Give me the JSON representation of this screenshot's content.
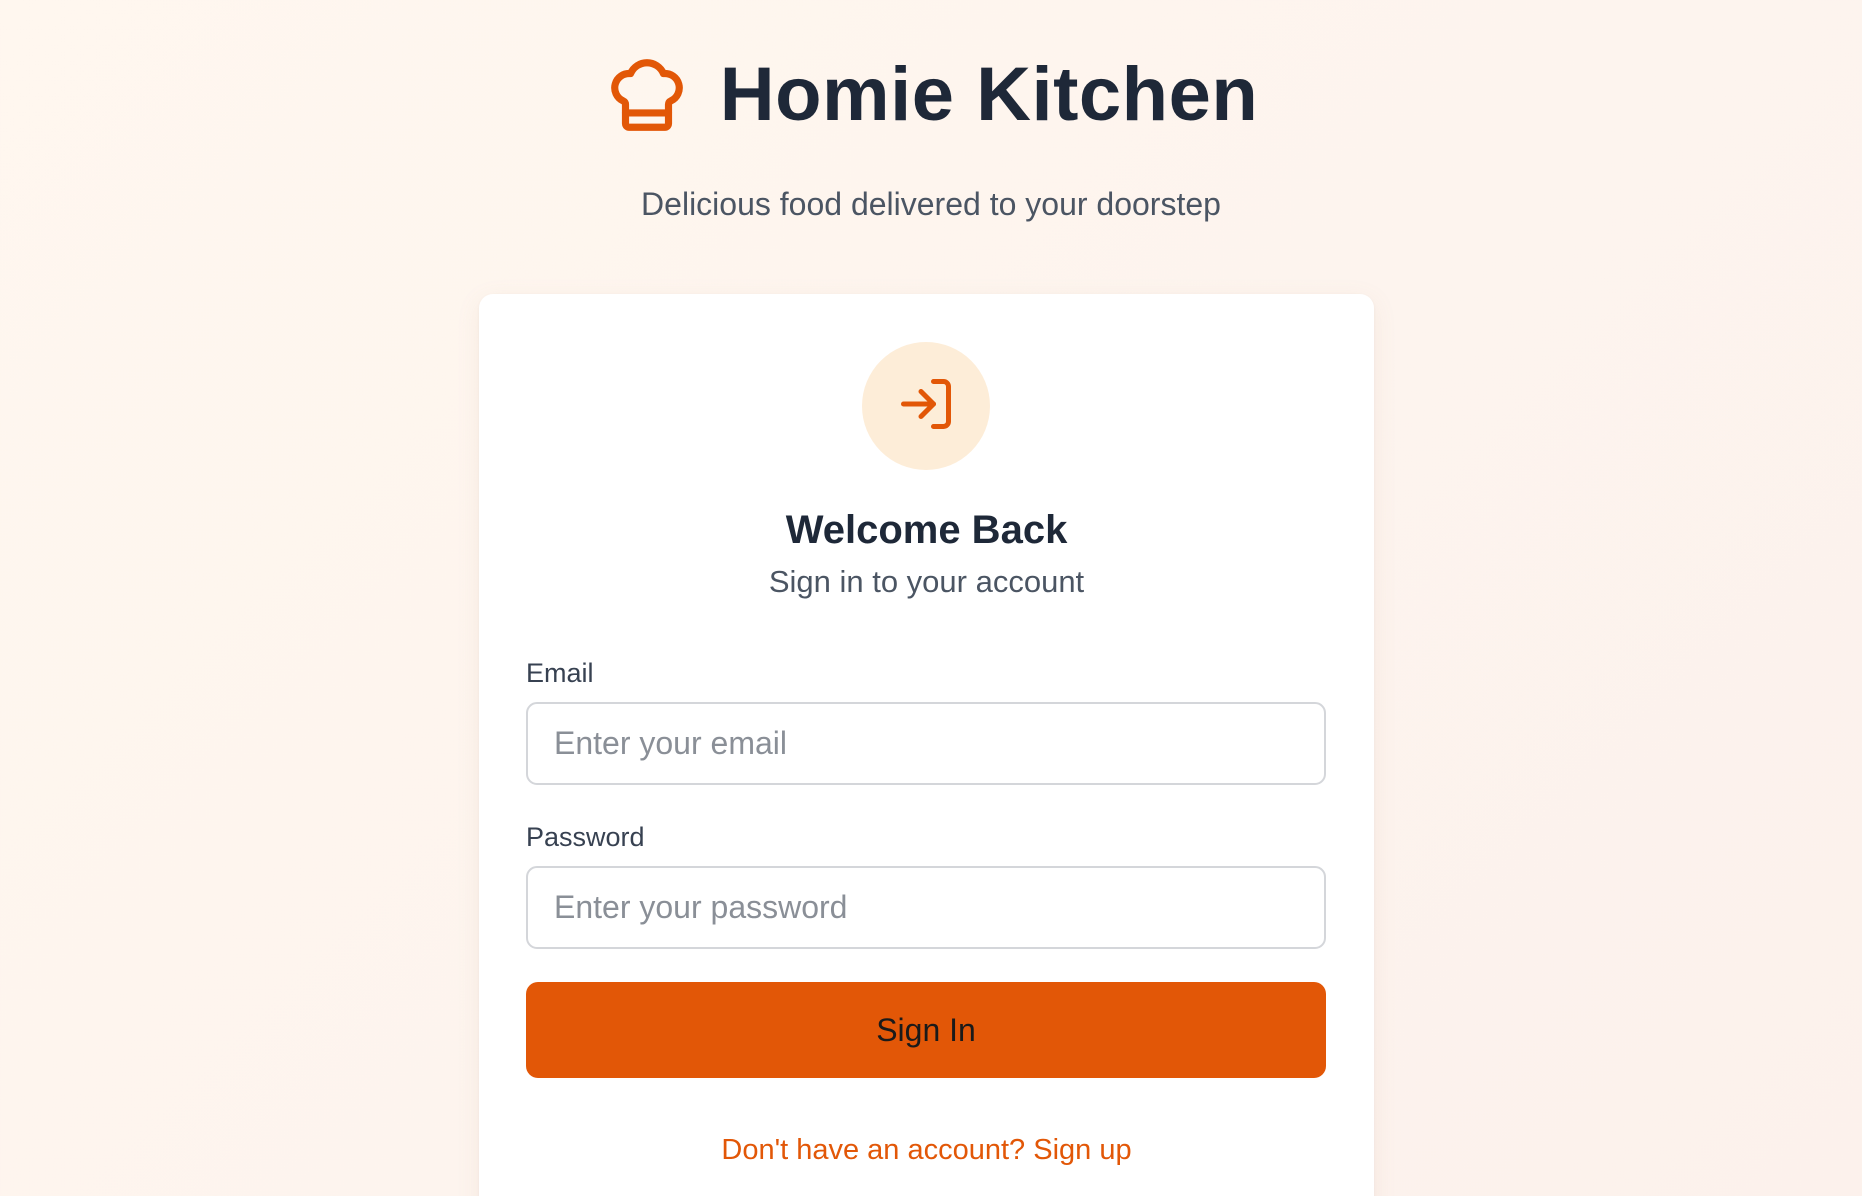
{
  "brand": {
    "name": "Homie Kitchen",
    "tagline": "Delicious food delivered to your doorstep",
    "icon": "chef-hat-icon",
    "accent_color": "#e25707"
  },
  "login": {
    "icon": "login-arrow-icon",
    "title": "Welcome Back",
    "subtitle": "Sign in to your account",
    "email": {
      "label": "Email",
      "placeholder": "Enter your email",
      "value": ""
    },
    "password": {
      "label": "Password",
      "placeholder": "Enter your password",
      "value": ""
    },
    "submit_label": "Sign In",
    "signup_text": "Don't have an account? Sign up"
  }
}
